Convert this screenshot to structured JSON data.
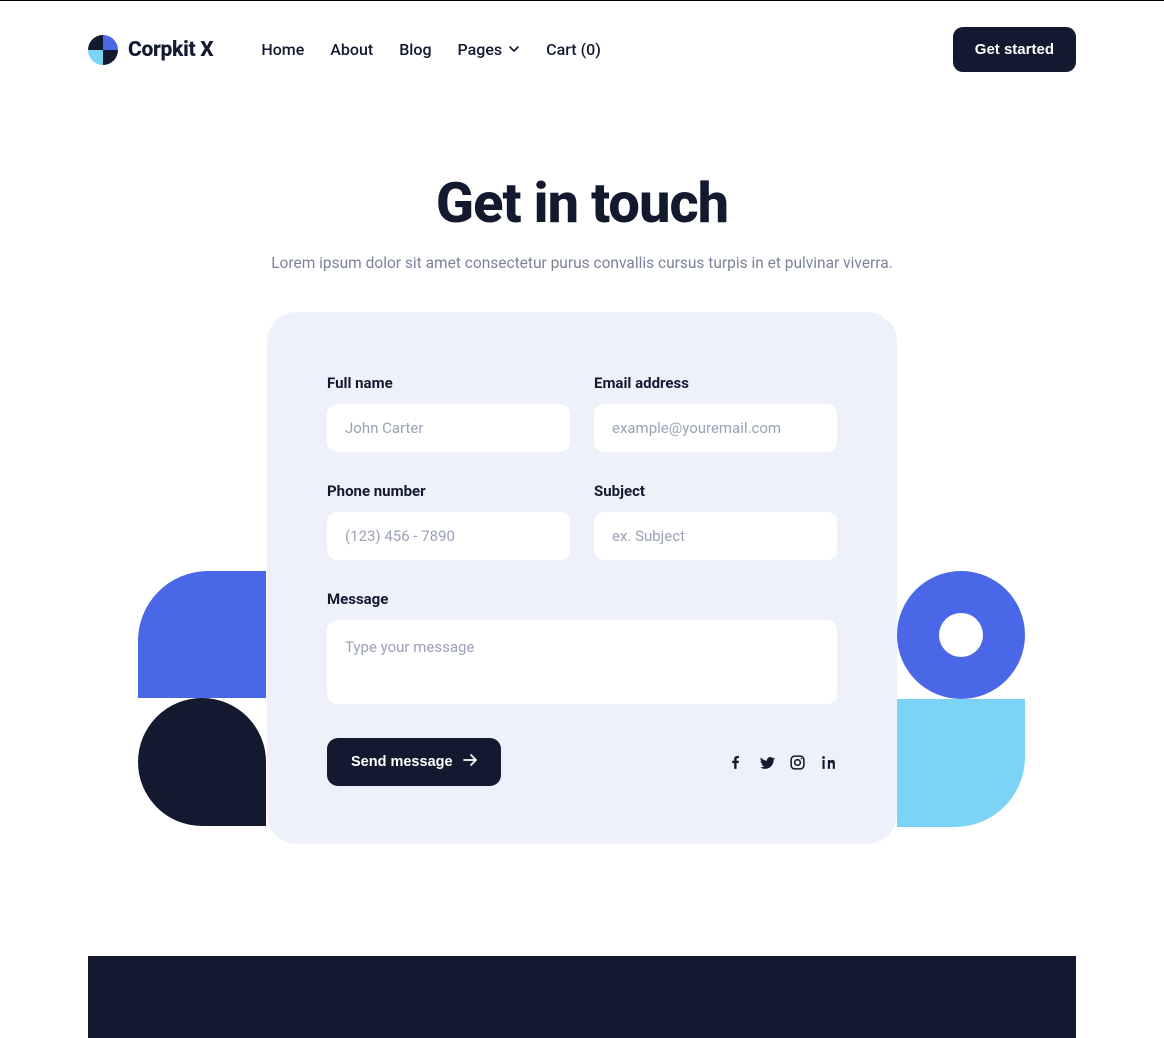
{
  "header": {
    "brand": "Corpkit X",
    "nav": {
      "home": "Home",
      "about": "About",
      "blog": "Blog",
      "pages": "Pages",
      "cart": "Cart (0)"
    },
    "cta": "Get started"
  },
  "hero": {
    "title": "Get in touch",
    "subtitle": "Lorem ipsum dolor sit amet consectetur purus convallis cursus turpis in et pulvinar viverra."
  },
  "form": {
    "fields": {
      "full_name": {
        "label": "Full name",
        "placeholder": "John Carter"
      },
      "email": {
        "label": "Email address",
        "placeholder": "example@youremail.com"
      },
      "phone": {
        "label": "Phone number",
        "placeholder": "(123) 456 - 7890"
      },
      "subject": {
        "label": "Subject",
        "placeholder": "ex. Subject"
      },
      "message": {
        "label": "Message",
        "placeholder": "Type your message"
      }
    },
    "submit": "Send message"
  }
}
